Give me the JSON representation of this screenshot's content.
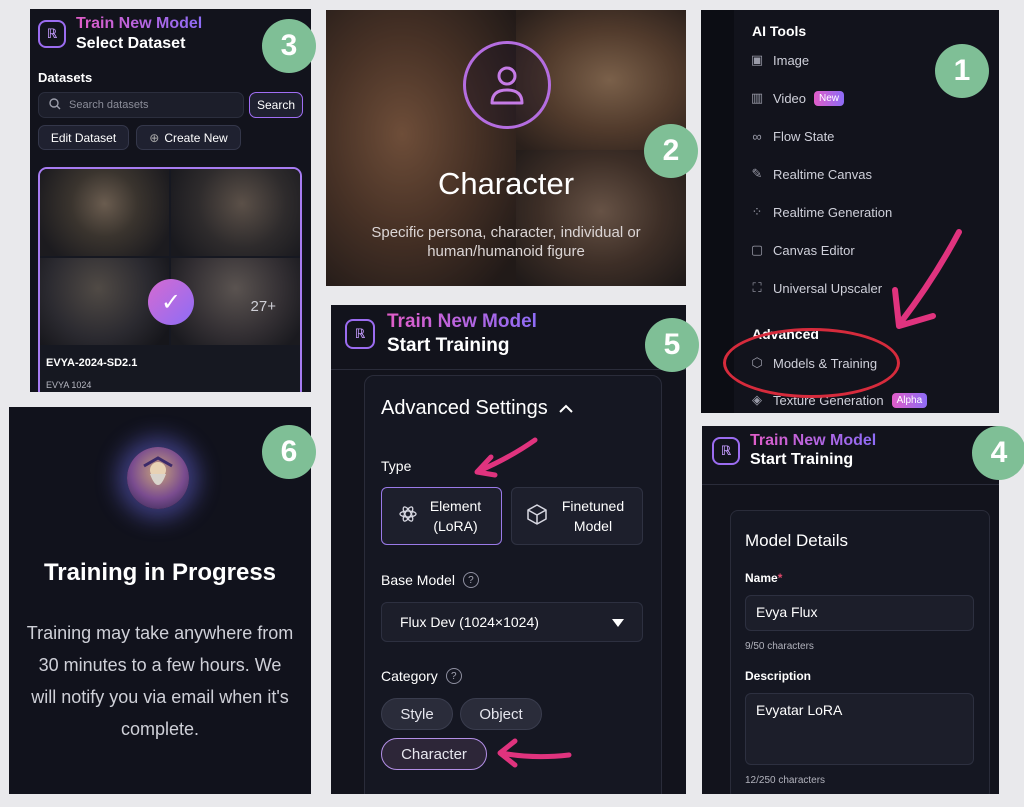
{
  "panel3": {
    "header": {
      "title": "Train New Model",
      "subtitle": "Select Dataset"
    },
    "datasets_label": "Datasets",
    "search": {
      "placeholder": "Search datasets",
      "button": "Search"
    },
    "edit_button": "Edit Dataset",
    "create_button": "Create New",
    "card": {
      "more_count": "27+",
      "name": "EVYA-2024-SD2.1",
      "sub": "EVYA 1024"
    },
    "step": "3"
  },
  "panel2": {
    "title": "Character",
    "description": "Specific persona, character, individual or human/humanoid figure",
    "step": "2"
  },
  "panel1": {
    "section_ai_tools": "AI Tools",
    "items": [
      {
        "label": "Image",
        "icon": "image-icon"
      },
      {
        "label": "Video",
        "icon": "video-icon",
        "tag": "New"
      },
      {
        "label": "Flow State",
        "icon": "infinity-icon"
      },
      {
        "label": "Realtime Canvas",
        "icon": "brush-icon"
      },
      {
        "label": "Realtime Generation",
        "icon": "grid-dots-icon"
      },
      {
        "label": "Canvas Editor",
        "icon": "canvas-icon"
      },
      {
        "label": "Universal Upscaler",
        "icon": "upscale-icon"
      }
    ],
    "section_advanced": "Advanced",
    "advanced_items": [
      {
        "label": "Models & Training",
        "icon": "cube-icon"
      },
      {
        "label": "Texture Generation",
        "icon": "texture-icon",
        "tag": "Alpha"
      }
    ],
    "step": "1"
  },
  "panel4": {
    "header": {
      "title": "Train New Model",
      "subtitle": "Start Training"
    },
    "box_title": "Model Details",
    "name_label": "Name",
    "name_value": "Evya Flux",
    "name_count": "9/50 characters",
    "desc_label": "Description",
    "desc_value": "Evyatar LoRA",
    "desc_count": "12/250 characters",
    "step": "4"
  },
  "panel5": {
    "header": {
      "title": "Train New Model",
      "subtitle": "Start Training"
    },
    "advanced": "Advanced Settings",
    "type_label": "Type",
    "type_options": [
      {
        "label": "Element (LoRA)"
      },
      {
        "label": "Finetuned Model"
      }
    ],
    "base_model_label": "Base Model",
    "base_model_value": "Flux Dev (1024×1024)",
    "category_label": "Category",
    "categories": [
      "Style",
      "Object",
      "Character"
    ],
    "step": "5"
  },
  "panel6": {
    "title": "Training in Progress",
    "description": "Training may take anywhere from 30 minutes to a few hours. We will notify you via email when it's complete.",
    "step": "6"
  },
  "colors": {
    "accent_pink": "#e15dc8",
    "accent_purple": "#8d6cf6",
    "badge_green": "#7fbf96",
    "annotation_arrow": "#e0337e",
    "annotation_circle": "#d62b3c"
  }
}
